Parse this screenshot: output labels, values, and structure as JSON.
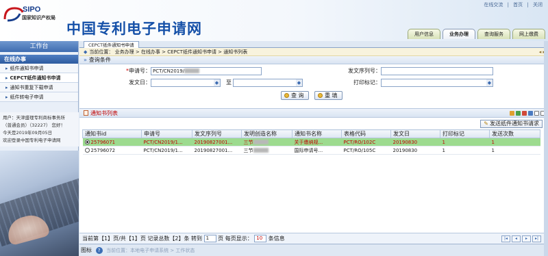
{
  "header": {
    "logo_text": "SIPO",
    "org_name": "国家知识产权局",
    "site_title": "中国专利电子申请网",
    "top_links": [
      "在线交流",
      "|",
      "首页",
      "|",
      "关闭"
    ],
    "tabs": [
      {
        "label": "用户信息"
      },
      {
        "label": "业务办理"
      },
      {
        "label": "查询服务"
      },
      {
        "label": "网上缴费"
      }
    ]
  },
  "sidebar": {
    "head": "工作台",
    "group": "在线办事",
    "items": [
      {
        "label": "纸件通知书申请"
      },
      {
        "label": "CEPCT纸件通知书申请"
      },
      {
        "label": "通知书重复下载申请"
      },
      {
        "label": "纸件转电子申请"
      }
    ],
    "user_lines": [
      "用户：天津盛理专利商标事务所",
      "（普通会员）（32227）    您好！",
      "       今天是2019年09月05日",
      "欢迎登录中国专利电子申请网"
    ]
  },
  "main": {
    "page_tab": "CEPCT纸件通知书申请",
    "breadcrumb": "当前位置：  业务办理  >  在线办事  >  CEPCT纸件通知书申请  >  通知书列表",
    "crumb_tools": "◂ ▸",
    "query_title": "查询条件",
    "form": {
      "app_no_label": "申请号：",
      "app_no_value": "PCT/CN2019/",
      "doc_no_label": "发文序列号：",
      "doc_no_value": "",
      "send_date_label": "发文日：",
      "to_label": "至",
      "print_flag_label": "打印标记：",
      "query_btn": "查 询",
      "reset_btn": "重 填"
    },
    "list_title": "通知书列表",
    "send_btn": "发送纸件通知书请求",
    "table": {
      "headers": [
        "通知书id",
        "申请号",
        "发文序列号",
        "发明创造名称",
        "通知书名称",
        "表格代码",
        "发文日",
        "打印标记",
        "发送次数"
      ],
      "rows": [
        {
          "id": "25796071",
          "app_no": "PCT/CN2019/1...",
          "doc_no": "20190827001...",
          "invention": "三节",
          "notice": "关于缴纳规...",
          "form_code": "PCT/RO/102C",
          "date": "20190830",
          "print": "1",
          "count": "1"
        },
        {
          "id": "25796072",
          "app_no": "PCT/CN2019/1...",
          "doc_no": "20190827001...",
          "invention": "三节",
          "notice": "国际申请号...",
          "form_code": "PCT/RO/105C",
          "date": "20190830",
          "print": "1",
          "count": "1"
        }
      ]
    },
    "pager": {
      "t1": "当前第【1】页/共【1】页 记录总数【2】条 转到",
      "goto_value": "1",
      "t2": "页 每页显示：",
      "per_page": "10",
      "t3": "条信息"
    },
    "status": {
      "label": "图标",
      "help": "?",
      "faded": "当前位置：本地电子申请系统 > 工作状态"
    }
  }
}
